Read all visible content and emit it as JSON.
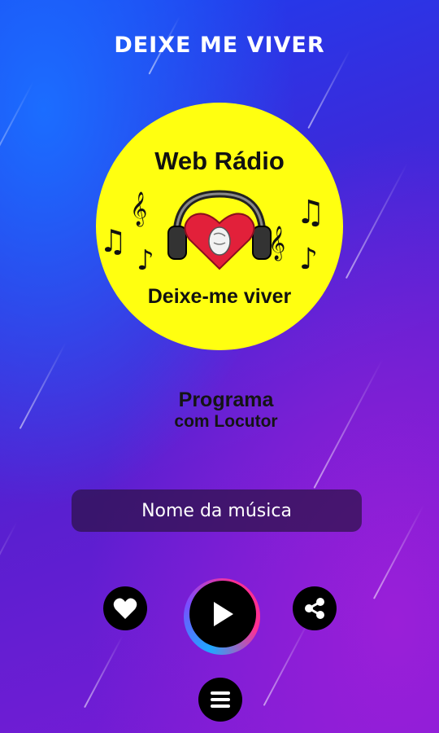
{
  "header": {
    "title": "DEIXE ME VIVER"
  },
  "logo": {
    "top_text": "Web Rádio",
    "bottom_text": "Deixe-me viver",
    "icons": [
      "music-note-icon",
      "treble-clef-icon",
      "headphones-icon",
      "heart-icon"
    ]
  },
  "program": {
    "line1": "Programa",
    "line2": "com Locutor"
  },
  "player": {
    "song_name": "Nome da música"
  },
  "controls": {
    "like_icon": "heart-icon",
    "play_icon": "play-icon",
    "share_icon": "share-icon",
    "menu_icon": "menu-icon"
  },
  "colors": {
    "logo_background": "#ffff10",
    "heart": "#e2203a",
    "button": "#000000",
    "play_ring": [
      "#1fa8ff",
      "#ff2f92"
    ]
  }
}
